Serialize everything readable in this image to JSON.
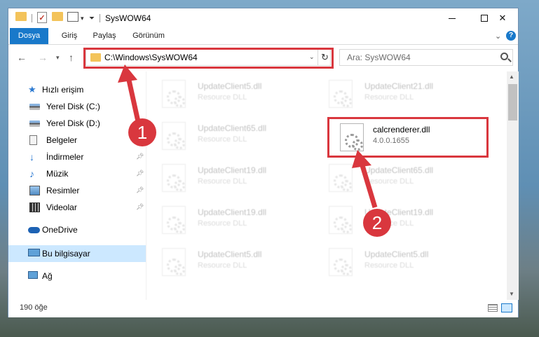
{
  "window": {
    "title": "SysWOW64"
  },
  "ribbon": {
    "tabs": [
      "Dosya",
      "Giriş",
      "Paylaş",
      "Görünüm"
    ]
  },
  "address": {
    "path": "C:\\Windows\\SysWOW64"
  },
  "search": {
    "placeholder": "Ara: SysWOW64"
  },
  "navpane": {
    "items": [
      {
        "label": "Hızlı erişim",
        "icon": "star-icon"
      },
      {
        "label": "Yerel Disk (C:)",
        "icon": "drive-icon"
      },
      {
        "label": "Yerel Disk (D:)",
        "icon": "drive-icon"
      },
      {
        "label": "Belgeler",
        "icon": "documents-icon"
      },
      {
        "label": "İndirmeler",
        "icon": "download-icon"
      },
      {
        "label": "Müzik",
        "icon": "music-icon"
      },
      {
        "label": "Resimler",
        "icon": "pictures-icon"
      },
      {
        "label": "Videolar",
        "icon": "video-icon"
      },
      {
        "label": "OneDrive",
        "icon": "cloud-icon"
      },
      {
        "label": "Bu bilgisayar",
        "icon": "computer-icon"
      },
      {
        "label": "Ağ",
        "icon": "network-icon"
      }
    ]
  },
  "files": {
    "left": [
      {
        "name": "UpdateClient5.dll",
        "desc": "Resource DLL"
      },
      {
        "name": "UpdateClient65.dll",
        "desc": "Resource DLL"
      },
      {
        "name": "UpdateClient19.dll",
        "desc": "Resource DLL"
      },
      {
        "name": "UpdateClient19.dll",
        "desc": "Resource DLL"
      },
      {
        "name": "UpdateClient5.dll",
        "desc": "Resource DLL"
      }
    ],
    "right": [
      {
        "name": "UpdateClient21.dll",
        "desc": "Resource DLL"
      },
      {
        "name": "calcrenderer.dll",
        "desc": "4.0.0.1655"
      },
      {
        "name": "UpdateClient65.dll",
        "desc": "Resource DLL"
      },
      {
        "name": "UpdateClient19.dll",
        "desc": "Resource DLL"
      },
      {
        "name": "UpdateClient5.dll",
        "desc": "Resource DLL"
      }
    ]
  },
  "status": {
    "count": "190 öğe"
  },
  "annotations": {
    "step1": "1",
    "step2": "2"
  },
  "colors": {
    "accent": "#1979ca",
    "highlight": "#d9373e"
  }
}
